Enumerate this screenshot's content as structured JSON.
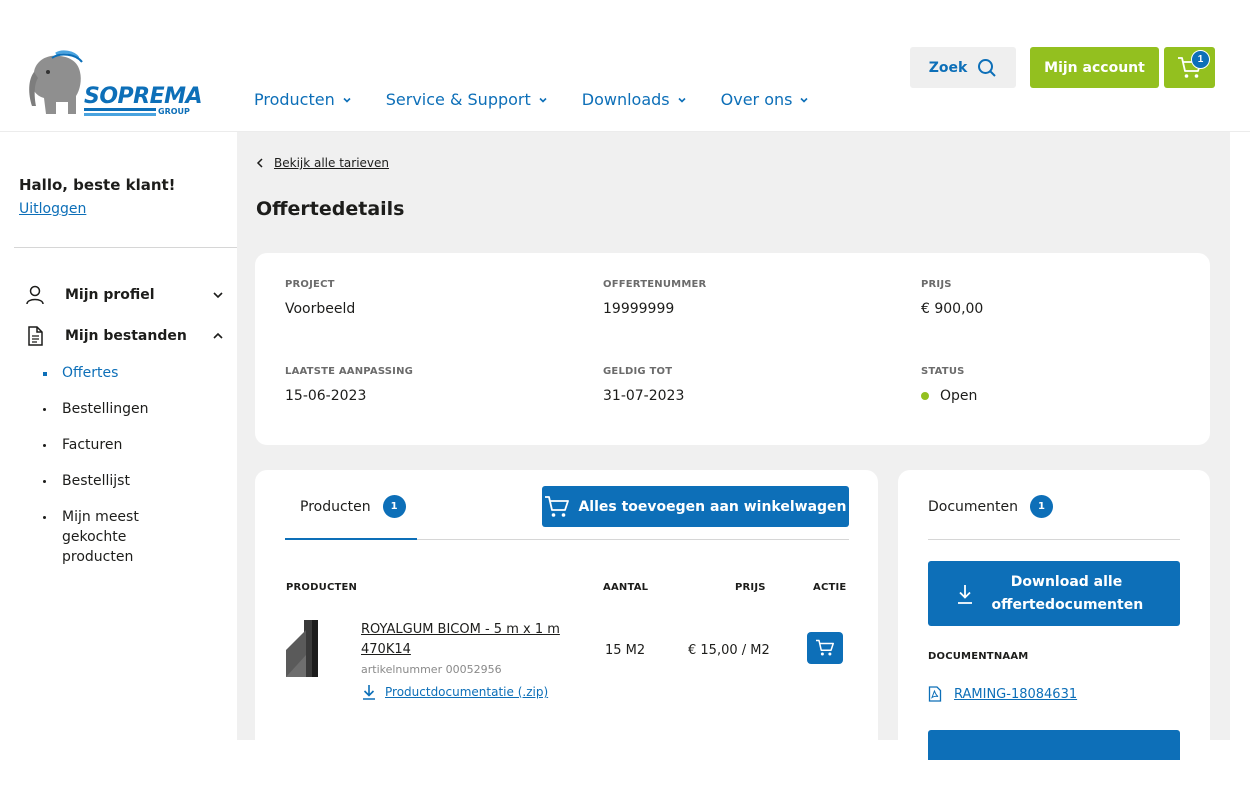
{
  "brand": {
    "name": "SOPREMA",
    "sub": "GROUP",
    "primary_color": "#0d6fb8",
    "accent_color": "#93c01f"
  },
  "header": {
    "nav": [
      {
        "label": "Producten"
      },
      {
        "label": "Service & Support"
      },
      {
        "label": "Downloads"
      },
      {
        "label": "Over ons"
      }
    ],
    "search_label": "Zoek",
    "account_label": "Mijn account",
    "cart_count": "1"
  },
  "sidebar": {
    "greeting": "Hallo, beste klant!",
    "logout": "Uitloggen",
    "profile_label": "Mijn profiel",
    "files_label": "Mijn bestanden",
    "items": [
      {
        "label": "Offertes",
        "active": true
      },
      {
        "label": "Bestellingen"
      },
      {
        "label": "Facturen"
      },
      {
        "label": "Bestellijst"
      },
      {
        "label": "Mijn meest gekochte producten"
      }
    ]
  },
  "main": {
    "back_link": "Bekijk alle tarieven",
    "title": "Offertedetails",
    "details": {
      "project_label": "PROJECT",
      "project_value": "Voorbeeld",
      "quote_number_label": "OFFERTENUMMER",
      "quote_number_value": "19999999",
      "price_label": "PRIJS",
      "price_value": "€ 900,00",
      "last_modified_label": "LAATSTE AANPASSING",
      "last_modified_value": "15-06-2023",
      "valid_until_label": "GELDIG TOT",
      "valid_until_value": "31-07-2023",
      "status_label": "STATUS",
      "status_value": "Open",
      "status_color": "#93c01f"
    },
    "products": {
      "tab_label": "Producten",
      "count": "1",
      "add_all_label": "Alles toevoegen aan winkelwagen",
      "columns": [
        "PRODUCTEN",
        "AANTAL",
        "PRIJS",
        "ACTIE"
      ],
      "rows": [
        {
          "name": "ROYALGUM BICOM - 5 m x 1 m 470K14",
          "article": "artikelnummer 00052956",
          "doc_link": "Productdocumentatie (.zip)",
          "quantity": "15 M2",
          "price": "€ 15,00 / M2"
        }
      ]
    },
    "documents": {
      "tab_label": "Documenten",
      "count": "1",
      "download_all_label": "Download alle offertedocumenten",
      "column": "DOCUMENTNAAM",
      "items": [
        {
          "name": "RAMING-18084631"
        }
      ]
    }
  }
}
